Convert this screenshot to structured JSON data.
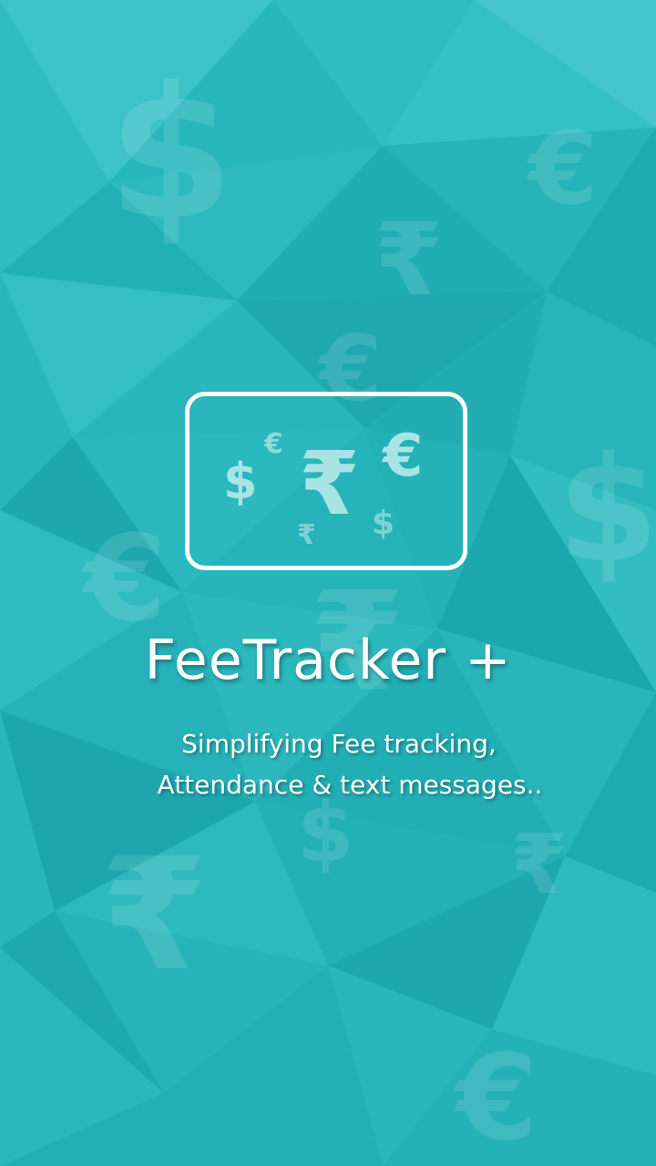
{
  "app": {
    "title": "FeeTracker +",
    "tagline_line1": "Simplifying Fee tracking,",
    "tagline_line2": "Attendance & text messages.."
  },
  "logo": {
    "symbols": [
      "$",
      "€",
      "₹",
      "€",
      "₹",
      "$"
    ]
  },
  "background": {
    "symbols": [
      "$",
      "€",
      "₹",
      "€",
      "$",
      "€",
      "₹",
      "$",
      "₹",
      "€",
      "₹"
    ]
  },
  "colors": {
    "background": "#26b6bd",
    "logo_symbol": "#a8e4e4",
    "text": "#ffffff"
  }
}
